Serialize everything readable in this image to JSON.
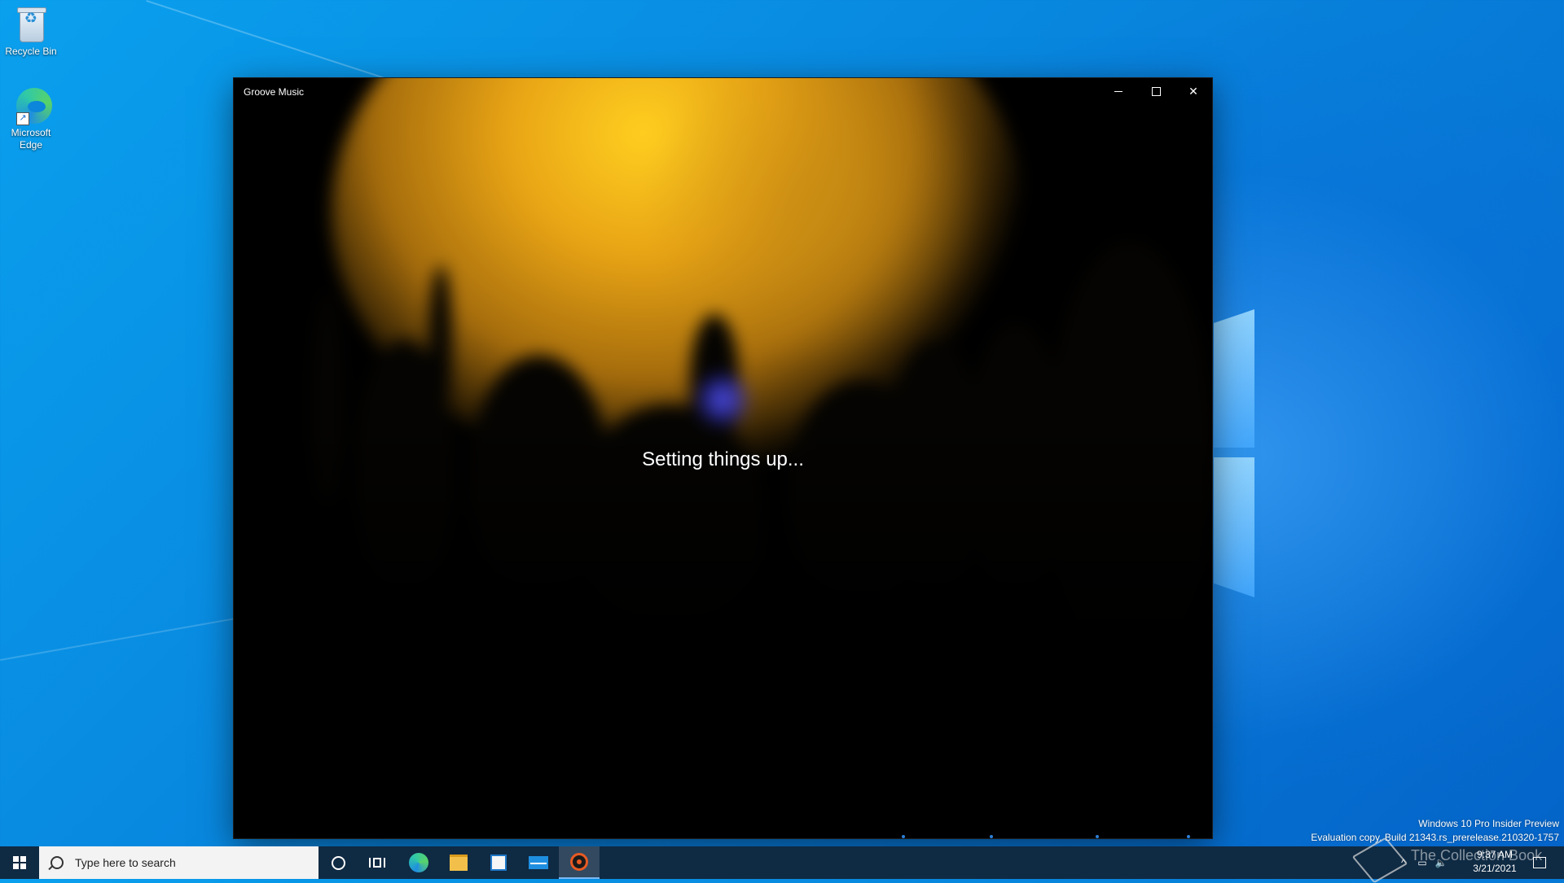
{
  "desktop": {
    "icons": [
      {
        "label": "Recycle Bin"
      },
      {
        "label": "Microsoft Edge"
      }
    ],
    "watermark": {
      "line1": "Windows 10 Pro Insider Preview",
      "line2": "Evaluation copy. Build 21343.rs_prerelease.210320-1757"
    },
    "overlay_text": "The Collection Book"
  },
  "window": {
    "title": "Groove Music",
    "status": "Setting things up...",
    "controls": {
      "minimize": "minimize",
      "maximize": "maximize",
      "close": "close"
    }
  },
  "taskbar": {
    "search_placeholder": "Type here to search",
    "pinned": [
      "edge-icon",
      "file-explorer-icon",
      "store-icon",
      "mail-icon",
      "groove-music-icon"
    ],
    "active_app": "Groove Music",
    "clock": {
      "time": "9:37 AM",
      "date": "3/21/2021"
    },
    "tray_icons": [
      "chevron-up-icon",
      "network-icon",
      "volume-icon",
      "notification-icon"
    ]
  },
  "colors": {
    "accent": "#0078d7",
    "taskbar": "#0f2a43",
    "groove_orange": "#e85a23"
  }
}
